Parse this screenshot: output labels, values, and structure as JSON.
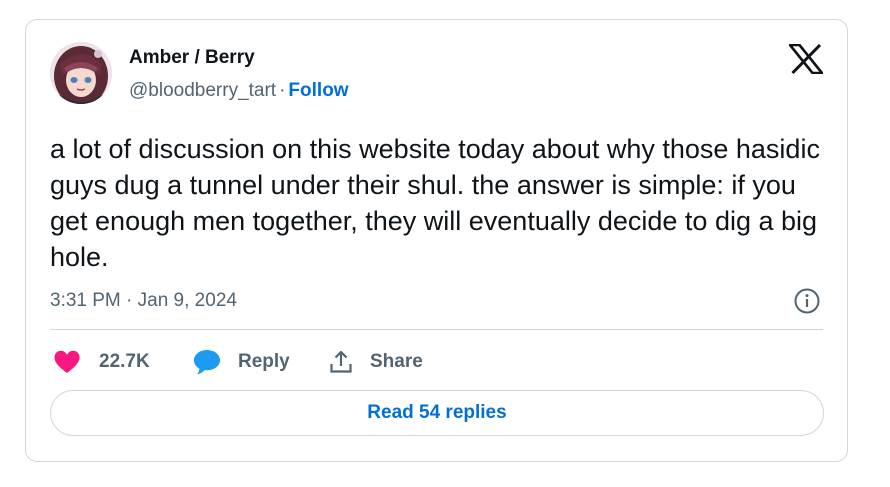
{
  "author": {
    "display_name": "Amber / Berry",
    "handle": "@bloodberry_tart",
    "separator": "·",
    "follow_label": "Follow"
  },
  "tweet": {
    "text": "a lot of discussion on this website today about why those hasidic guys dug a tunnel under their shul. the answer is simple: if you get enough men together, they will eventually decide to dig a big hole.",
    "timestamp": "3:31 PM · Jan 9, 2024"
  },
  "actions": {
    "like_count": "22.7K",
    "reply_label": "Reply",
    "share_label": "Share"
  },
  "read_replies_label": "Read 54 replies",
  "icons": [
    "x-logo-icon",
    "info-icon",
    "heart-icon",
    "reply-bubble-icon",
    "share-icon"
  ],
  "colors": {
    "link_blue": "#006fd6",
    "like_pink": "#f91880",
    "reply_blue": "#1d9bf0",
    "secondary_text": "#536471",
    "border": "#cfd9de"
  }
}
